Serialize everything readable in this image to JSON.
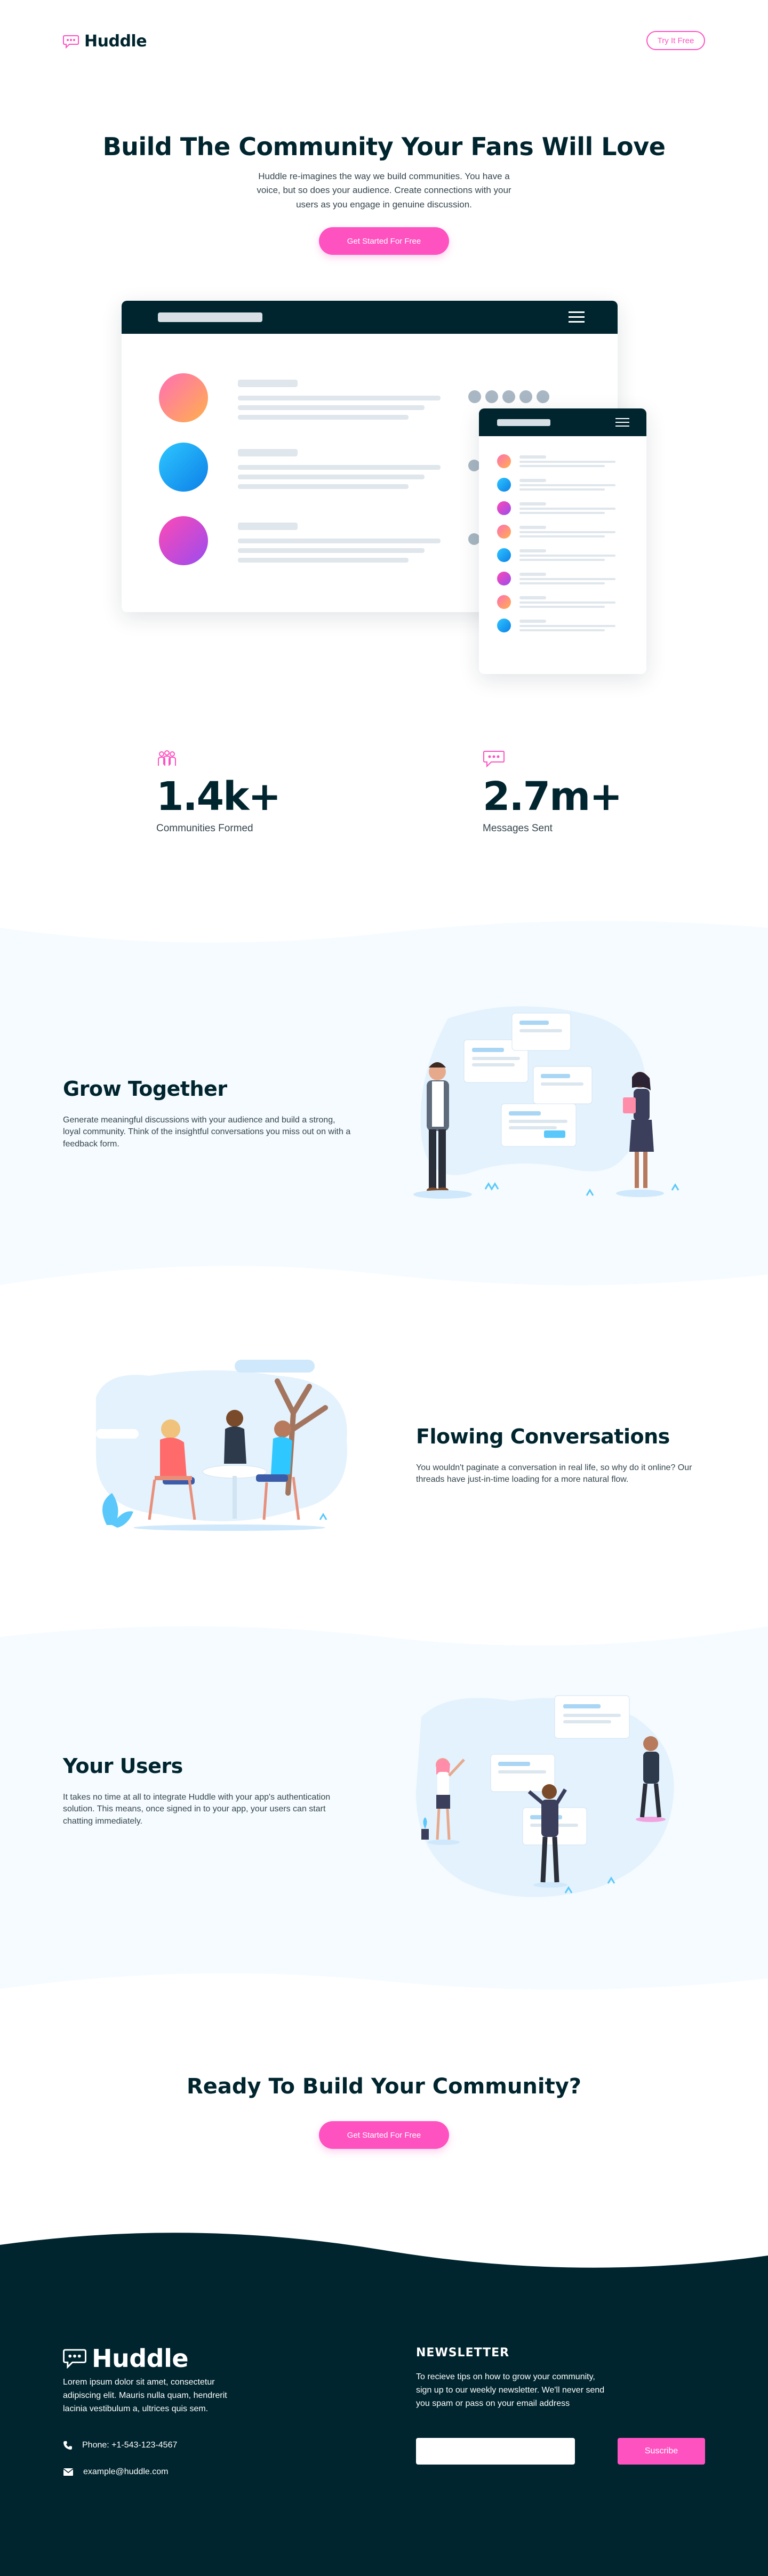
{
  "header": {
    "logo_text": "Huddle",
    "try_label": "Try It Free"
  },
  "hero": {
    "title": "Build The Community Your Fans Will Love",
    "subtitle": "Huddle re-imagines the way we build communities. You have a voice, but so does your audience. Create connections with your users as you engage in genuine discussion.",
    "cta_label": "Get Started For Free"
  },
  "stats": [
    {
      "value": "1.4k+",
      "label": "Communities Formed",
      "icon": "communities-icon"
    },
    {
      "value": "2.7m+",
      "label": "Messages Sent",
      "icon": "messages-icon"
    }
  ],
  "features": [
    {
      "title": "Grow Together",
      "text": "Generate meaningful discussions with your audience and build a strong, loyal community. Think of the insightful conversations you miss out on with a feedback form.",
      "illustration": "grow-together-illustration"
    },
    {
      "title": "Flowing Conversations",
      "text": "You wouldn't paginate a conversation in real life, so why do it online? Our threads have just-in-time loading for a more natural flow.",
      "illustration": "flowing-conversations-illustration"
    },
    {
      "title": "Your Users",
      "text": "It takes no time at all to integrate Huddle with your app's authentication solution. This means, once signed in to your app, your users can start chatting immediately.",
      "illustration": "your-users-illustration"
    }
  ],
  "cta": {
    "title": "Ready To Build Your Community?",
    "button_label": "Get Started For Free"
  },
  "footer": {
    "logo_text": "Huddle",
    "description": "Lorem ipsum dolor sit amet, consectetur adipiscing elit. Mauris nulla quam, hendrerit lacinia vestibulum a, ultrices quis sem.",
    "phone": "Phone: +1-543-123-4567",
    "email": "example@huddle.com",
    "newsletter_title": "NEWSLETTER",
    "newsletter_text": "To recieve tips on how to grow your community, sign up to our weekly newsletter. We'll never send you spam or pass on your email address",
    "email_value": "",
    "subscribe_label": "Suscribe"
  },
  "colors": {
    "pink": "#ff52c1",
    "dark_cyan": "#00252e",
    "pale_blue": "#f5fbff"
  }
}
